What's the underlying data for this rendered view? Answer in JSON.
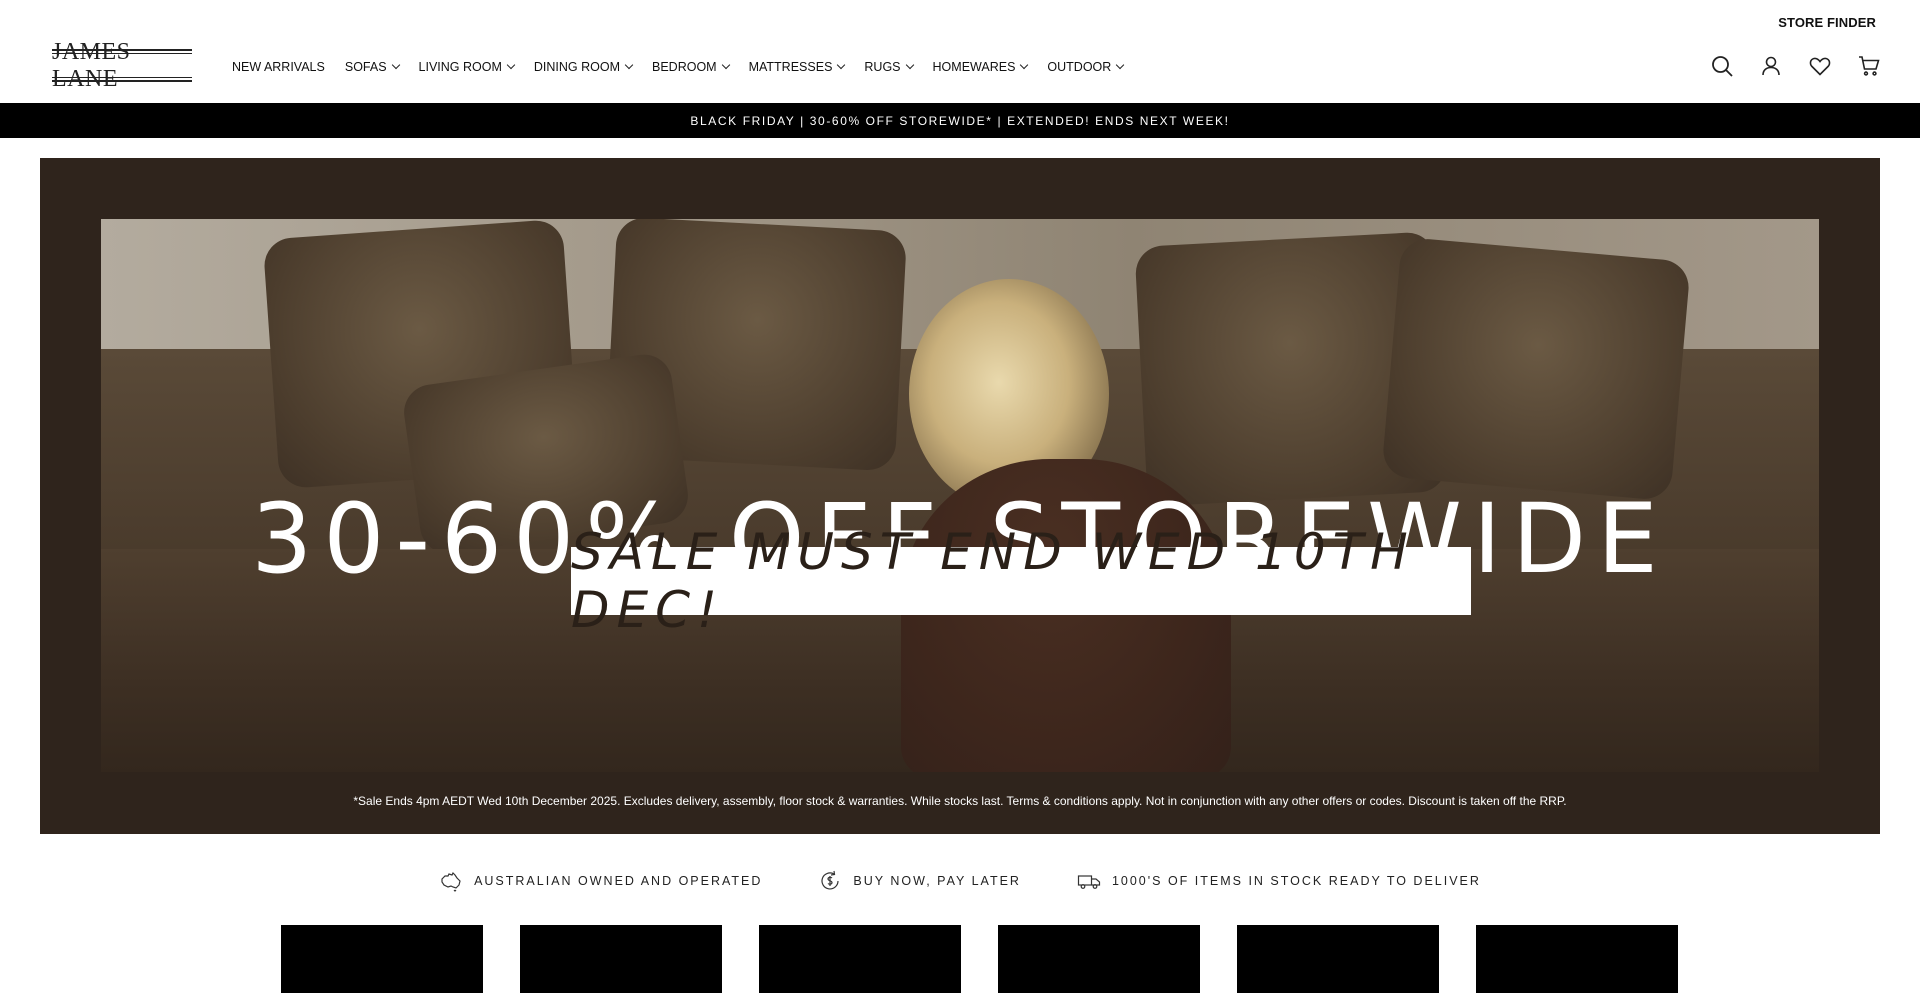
{
  "header": {
    "store_finder": "STORE FINDER",
    "logo_text": "JAMES LANE",
    "nav": [
      {
        "label": "NEW ARRIVALS",
        "dropdown": false
      },
      {
        "label": "SOFAS",
        "dropdown": true
      },
      {
        "label": "LIVING ROOM",
        "dropdown": true
      },
      {
        "label": "DINING ROOM",
        "dropdown": true
      },
      {
        "label": "BEDROOM",
        "dropdown": true
      },
      {
        "label": "MATTRESSES",
        "dropdown": true
      },
      {
        "label": "RUGS",
        "dropdown": true
      },
      {
        "label": "HOMEWARES",
        "dropdown": true
      },
      {
        "label": "OUTDOOR",
        "dropdown": true
      }
    ],
    "icons": [
      "search-icon",
      "account-icon",
      "wishlist-heart-icon",
      "cart-icon"
    ]
  },
  "announcement": "BLACK FRIDAY | 30-60% OFF STOREWIDE* | EXTENDED! ENDS NEXT WEEK!",
  "hero": {
    "headline": "30-60% OFF STOREWIDE",
    "subheadline": "SALE MUST END WED 10TH DEC!",
    "terms": "*Sale Ends 4pm AEDT Wed 10th December 2025. Excludes delivery, assembly, floor stock & warranties. While stocks last. Terms & conditions apply. Not in conjunction with any other offers or codes. Discount is taken off the RRP.",
    "frame_color": "#2f241c"
  },
  "usp": [
    {
      "icon": "australia-map-icon",
      "label": "AUSTRALIAN OWNED AND OPERATED"
    },
    {
      "icon": "pay-later-dollar-icon",
      "label": "BUY NOW, PAY LATER"
    },
    {
      "icon": "delivery-truck-icon",
      "label": "1000'S OF ITEMS IN STOCK READY TO DELIVER"
    }
  ],
  "colors": {
    "announcement_bg": "#000000",
    "text": "#111111"
  }
}
